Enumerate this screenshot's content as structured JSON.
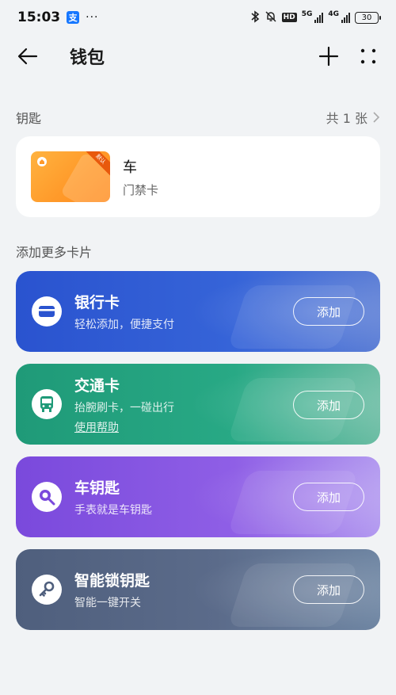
{
  "status_bar": {
    "time": "15:03",
    "alipay_icon": "支",
    "dots": "···",
    "hd": "HD",
    "net1": "5G",
    "net2": "4G",
    "battery": "30"
  },
  "header": {
    "title": "钱包"
  },
  "keys_section": {
    "title": "钥匙",
    "count": "共 1 张"
  },
  "key_card": {
    "ribbon": "默认",
    "name": "车",
    "type": "门禁卡"
  },
  "add_section": {
    "title": "添加更多卡片"
  },
  "add_cards": [
    {
      "title": "银行卡",
      "subtitle": "轻松添加，便捷支付",
      "button": "添加",
      "icon": "bank-card-icon",
      "color": "#2a53cf"
    },
    {
      "title": "交通卡",
      "subtitle": "抬腕刷卡，一碰出行",
      "link": "使用帮助",
      "button": "添加",
      "icon": "bus-icon",
      "color": "#1f9a78"
    },
    {
      "title": "车钥匙",
      "subtitle": "手表就是车钥匙",
      "button": "添加",
      "icon": "car-key-icon",
      "color": "#7a49dc"
    },
    {
      "title": "智能锁钥匙",
      "subtitle": "智能一键开关",
      "button": "添加",
      "icon": "key-icon",
      "color": "#4f5f7d"
    }
  ]
}
